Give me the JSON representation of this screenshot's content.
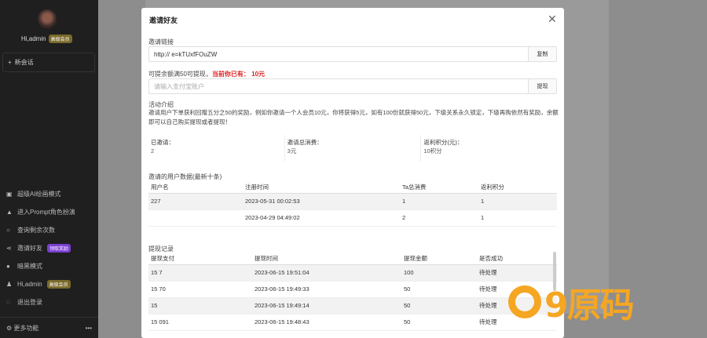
{
  "sidebar": {
    "user_name": "Hi,admin",
    "user_badge": "高级会员",
    "new_chat": "新会话",
    "items": [
      {
        "icon": "image-icon",
        "label": "超级AI绘画模式"
      },
      {
        "icon": "graduation-icon",
        "label": "进入Prompt角色扮演"
      },
      {
        "icon": "circle-icon",
        "label": "查询剩余次数"
      },
      {
        "icon": "share-icon",
        "label": "邀请好友",
        "badge": "领取奖励"
      },
      {
        "icon": "moon-icon",
        "label": "暗黑模式"
      },
      {
        "icon": "user-icon",
        "label": "Hi,admin",
        "badge": "高级会员"
      },
      {
        "icon": "logout-icon",
        "label": "退出登录"
      }
    ],
    "footer_label": "更多功能",
    "footer_more": "•••"
  },
  "modal": {
    "title": "邀请好友",
    "close": "✕",
    "invite_link_label": "邀请链接",
    "invite_link_value": "http://                           e=kTUxfFOuZW",
    "copy_button": "复制",
    "withdraw_label_prefix": "可提余额满50可提现，",
    "withdraw_label_current": "当前你已有：",
    "withdraw_amount": "10元",
    "alipay_placeholder": "请输入支付宝账户",
    "withdraw_button": "提现",
    "activity_label": "活动介绍",
    "activity_desc": "邀请用户下单获利回赠五分之50的奖励，例如你邀请一个人会员10元，你将获得5元，如有100份就获得50元，下级关系永久锁定，下级再购依然有奖励，余额即可以自己购买提现或者提现！",
    "stats": [
      {
        "label": "已邀请：",
        "value": "2"
      },
      {
        "label": "邀请总消费：",
        "value": "3元"
      },
      {
        "label": "返利积分(元)：",
        "value": "10积分"
      }
    ],
    "invited_label": "邀请的用户数据(最新十条)",
    "invited_table": {
      "headers": [
        "用户名",
        "注册时间",
        "Ta总消费",
        "返利积分"
      ],
      "rows": [
        [
          "227",
          "2023-05-31 00:02:53",
          "1",
          "1"
        ],
        [
          "",
          "2023-04-29 04:49:02",
          "2",
          "1"
        ]
      ]
    },
    "withdraw_record_label": "提现记录",
    "withdraw_table": {
      "headers": [
        "提现支付",
        "提现时间",
        "提现金额",
        "是否成功"
      ],
      "rows": [
        [
          "15    7",
          "2023-06-15 19:51:04",
          "100",
          "待处理"
        ],
        [
          "15    70",
          "2023-06-15 19:49:33",
          "50",
          "待处理"
        ],
        [
          "15",
          "2023-06-15 19:49:14",
          "50",
          "待处理"
        ],
        [
          "15   091",
          "2023-06-15 19:48:43",
          "50",
          "待处理"
        ]
      ]
    }
  },
  "watermark": {
    "text": "9原码"
  },
  "colors": {
    "accent_red": "#e02020",
    "badge_purple": "#7b3fd1",
    "watermark_orange": "#f5a623"
  }
}
